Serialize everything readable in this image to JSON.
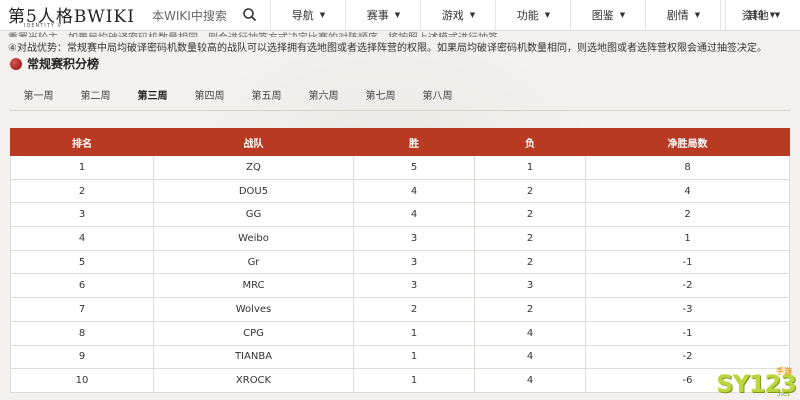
{
  "logo": {
    "title": "第5人格BWIKI",
    "subtitle": "IDENTITY V"
  },
  "search": {
    "placeholder": "本WIKI中搜索"
  },
  "nav": [
    "导航",
    "赛事",
    "游戏",
    "功能",
    "图鉴",
    "剧情",
    "资料",
    "其他"
  ],
  "intro": {
    "line1": "重置当轮主，如果局均破译密码机数量相同，则会进行抽签方式决定比赛的对阵顺序，将按照上述模式进行抽签。",
    "line2": "④对战优势：常规赛中局均破译密码机数量较高的战队可以选择拥有选地图或者选择阵营的权限。如果局均破译密码机数量相同，则选地图或者选阵营权限会通过抽签决定。"
  },
  "section": {
    "title": "常规赛积分榜"
  },
  "tabs": [
    "第一周",
    "第二周",
    "第三周",
    "第四周",
    "第五周",
    "第六周",
    "第七周",
    "第八周"
  ],
  "active_tab": "第三周",
  "table": {
    "headers": [
      "排名",
      "战队",
      "胜",
      "负",
      "净胜局数"
    ],
    "rows": [
      [
        "1",
        "ZQ",
        "5",
        "1",
        "8"
      ],
      [
        "2",
        "DOU5",
        "4",
        "2",
        "4"
      ],
      [
        "3",
        "GG",
        "4",
        "2",
        "2"
      ],
      [
        "4",
        "Weibo",
        "3",
        "2",
        "1"
      ],
      [
        "5",
        "Gr",
        "3",
        "2",
        "-1"
      ],
      [
        "6",
        "MRC",
        "3",
        "3",
        "-2"
      ],
      [
        "7",
        "Wolves",
        "2",
        "2",
        "-3"
      ],
      [
        "8",
        "CPG",
        "1",
        "4",
        "-1"
      ],
      [
        "9",
        "TIANBA",
        "1",
        "4",
        "-2"
      ],
      [
        "10",
        "XROCK",
        "1",
        "4",
        "-6"
      ]
    ]
  },
  "watermark": {
    "main": "SY123",
    "badge": "手游",
    "sub": ".net"
  },
  "colors": {
    "table_header": "#b83a22",
    "accent_green": "#bcd63d"
  },
  "icons": {
    "search": "search-icon",
    "caret": "chevron-down-icon",
    "section": "pin-icon"
  }
}
